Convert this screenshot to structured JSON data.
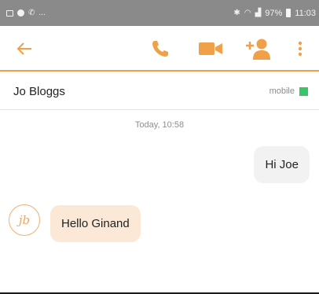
{
  "status_bar": {
    "left_icons": [
      "gallery-icon",
      "circle-icon",
      "wifi-call-icon"
    ],
    "overflow": "...",
    "battery": "97%",
    "time": "11:03"
  },
  "toolbar": {
    "accent_color": "#f0a048",
    "icons": [
      "back-arrow-icon",
      "phone-icon",
      "video-camera-icon",
      "add-user-icon",
      "overflow-menu-icon"
    ]
  },
  "contact": {
    "name": "Jo Bloggs",
    "presence_label": "mobile",
    "presence_color": "#3bc46a"
  },
  "conversation": {
    "timestamp": "Today, 10:58",
    "messages": [
      {
        "direction": "out",
        "text": "Hi Joe"
      },
      {
        "direction": "in",
        "avatar_initials": "jb",
        "text": "Hello Ginand"
      }
    ]
  }
}
